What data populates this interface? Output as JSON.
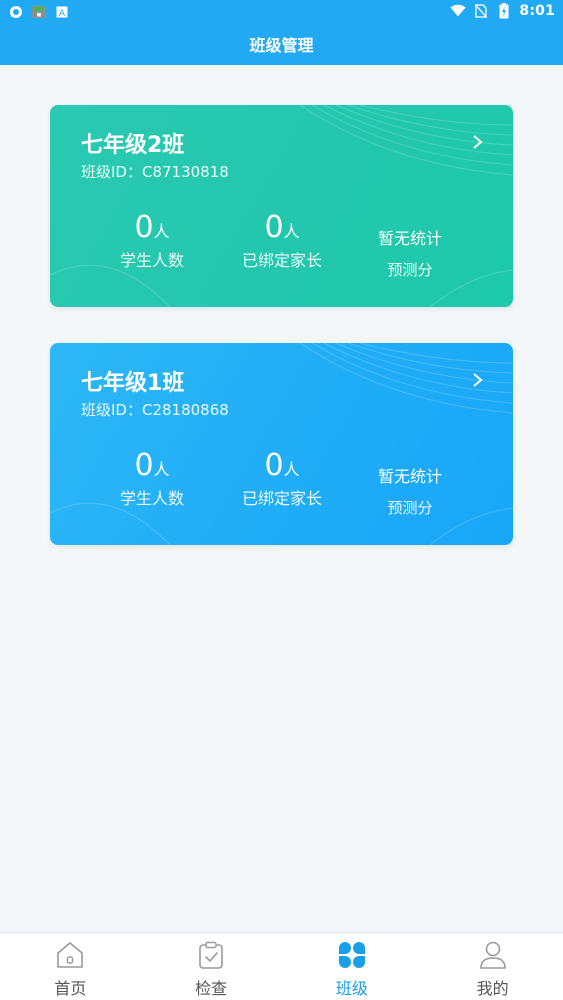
{
  "status_bar": {
    "time": "8:01"
  },
  "header": {
    "title": "班级管理"
  },
  "classes": [
    {
      "name": "七年级2班",
      "id_label": "班级ID：C87130818",
      "students": {
        "value": "0",
        "unit": "人",
        "label": "学生人数"
      },
      "parents": {
        "value": "0",
        "unit": "人",
        "label": "已绑定家长"
      },
      "score": {
        "value": "暂无统计",
        "label": "预测分"
      },
      "color": "#22c7ad"
    },
    {
      "name": "七年级1班",
      "id_label": "班级ID：C28180868",
      "students": {
        "value": "0",
        "unit": "人",
        "label": "学生人数"
      },
      "parents": {
        "value": "0",
        "unit": "人",
        "label": "已绑定家长"
      },
      "score": {
        "value": "暂无统计",
        "label": "预测分"
      },
      "color": "#20adf7"
    }
  ],
  "bottom_nav": {
    "items": [
      {
        "label": "首页",
        "icon": "home-icon",
        "active": false
      },
      {
        "label": "检查",
        "icon": "clipboard-check-icon",
        "active": false
      },
      {
        "label": "班级",
        "icon": "class-grid-icon",
        "active": true
      },
      {
        "label": "我的",
        "icon": "user-icon",
        "active": false
      }
    ],
    "active_color": "#1a9fe9"
  },
  "colors": {
    "primary": "#21aaf3",
    "background": "#f4f7fa"
  }
}
